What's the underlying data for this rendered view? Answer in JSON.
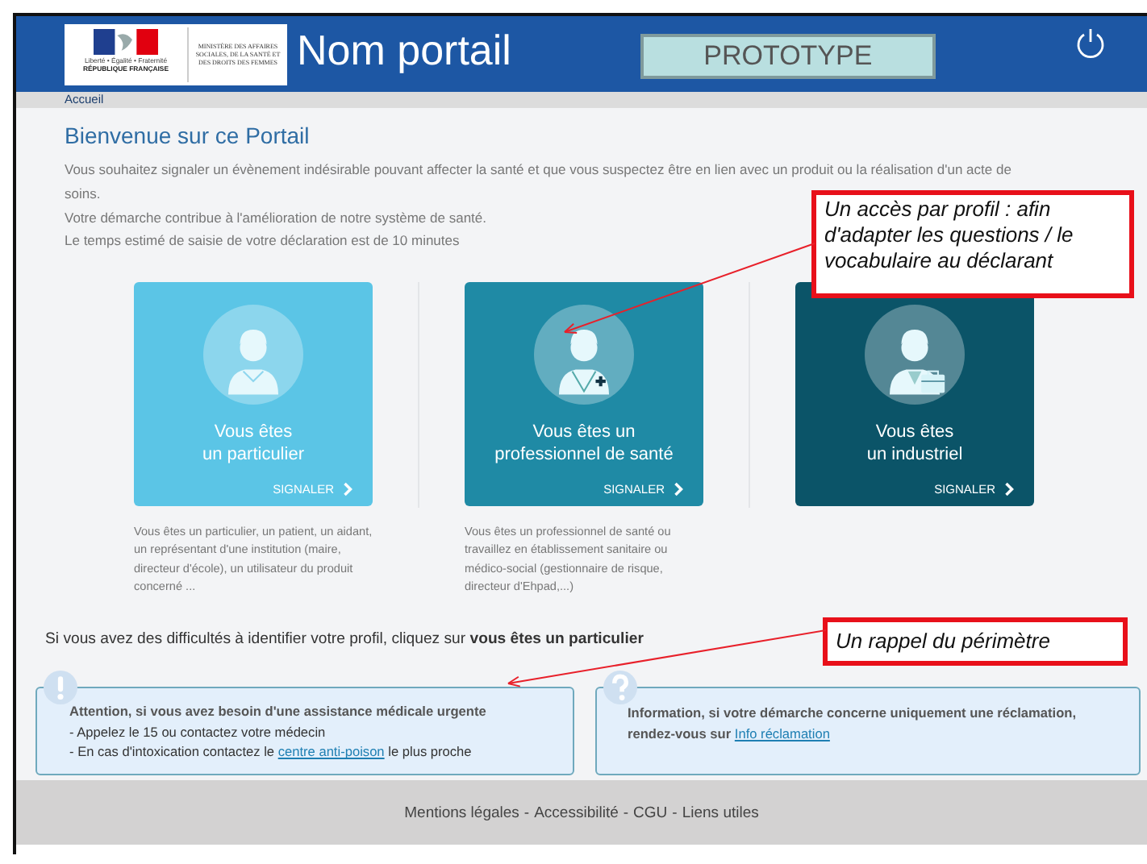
{
  "header": {
    "logo": {
      "motto": "Liberté • Égalité • Fraternité",
      "republic": "RÉPUBLIQUE FRANÇAISE",
      "ministry": "MINISTÈRE DES AFFAIRES SOCIALES, DE LA SANTÉ ET DES DROITS DES FEMMES"
    },
    "title": "Nom portail",
    "badge": "PROTOTYPE"
  },
  "breadcrumb": "Accueil",
  "welcome": {
    "title": "Bienvenue sur ce Portail",
    "paragraphs": [
      "Vous souhaitez signaler un évènement indésirable pouvant affecter la santé et que vous suspectez être en lien avec un produit ou la réalisation d'un acte de soins.",
      "Votre démarche contribue à l'amélioration de notre système de santé.",
      "Le temps estimé de saisie de votre déclaration est de 10 minutes"
    ]
  },
  "profiles": [
    {
      "kind": "person",
      "color": "#5bc5e6",
      "title": [
        "Vous êtes",
        "un particulier"
      ],
      "action": "SIGNALER",
      "description": "Vous êtes un particulier, un patient, un aidant, un représentant d'une institution (maire, directeur d'école), un utilisateur du produit concerné ..."
    },
    {
      "kind": "doctor",
      "color": "#1f8aa5",
      "title": [
        "Vous êtes un",
        "professionnel de santé"
      ],
      "action": "SIGNALER",
      "description": "Vous êtes un professionnel de santé ou travaillez en établissement sanitaire ou médico-social (gestionnaire de risque, directeur d'Ehpad,...)"
    },
    {
      "kind": "business",
      "color": "#0b5468",
      "title": [
        "Vous êtes",
        "un industriel"
      ],
      "action": "SIGNALER"
    }
  ],
  "hint": "Si vous avez des difficultés à identifier votre profil, cliquez sur **vous êtes un particulier**",
  "notices": [
    {
      "kind": "warning",
      "title": "Attention, si vous avez besoin d'une assistance médicale urgente",
      "lines": [
        {
          "before": "- Appelez le 15 ou contactez votre médecin"
        },
        {
          "before": "- En cas d'intoxication contactez le ",
          "link": "centre anti-poison",
          "after": " le plus proche"
        }
      ]
    },
    {
      "kind": "info",
      "lines": [
        {
          "before": "Information, si votre démarche concerne uniquement une réclamation, rendez-vous sur ",
          "link": "Info réclamation"
        }
      ]
    }
  ],
  "footer": {
    "links": [
      "Mentions légales",
      "Accessibilité",
      "CGU",
      "Liens utiles"
    ],
    "separator": "-"
  },
  "annotations": [
    {
      "text": "Un accès par profil : afin d'adapter les questions / le vocabulaire au déclarant"
    },
    {
      "text": "Un rappel du périmètre"
    }
  ]
}
